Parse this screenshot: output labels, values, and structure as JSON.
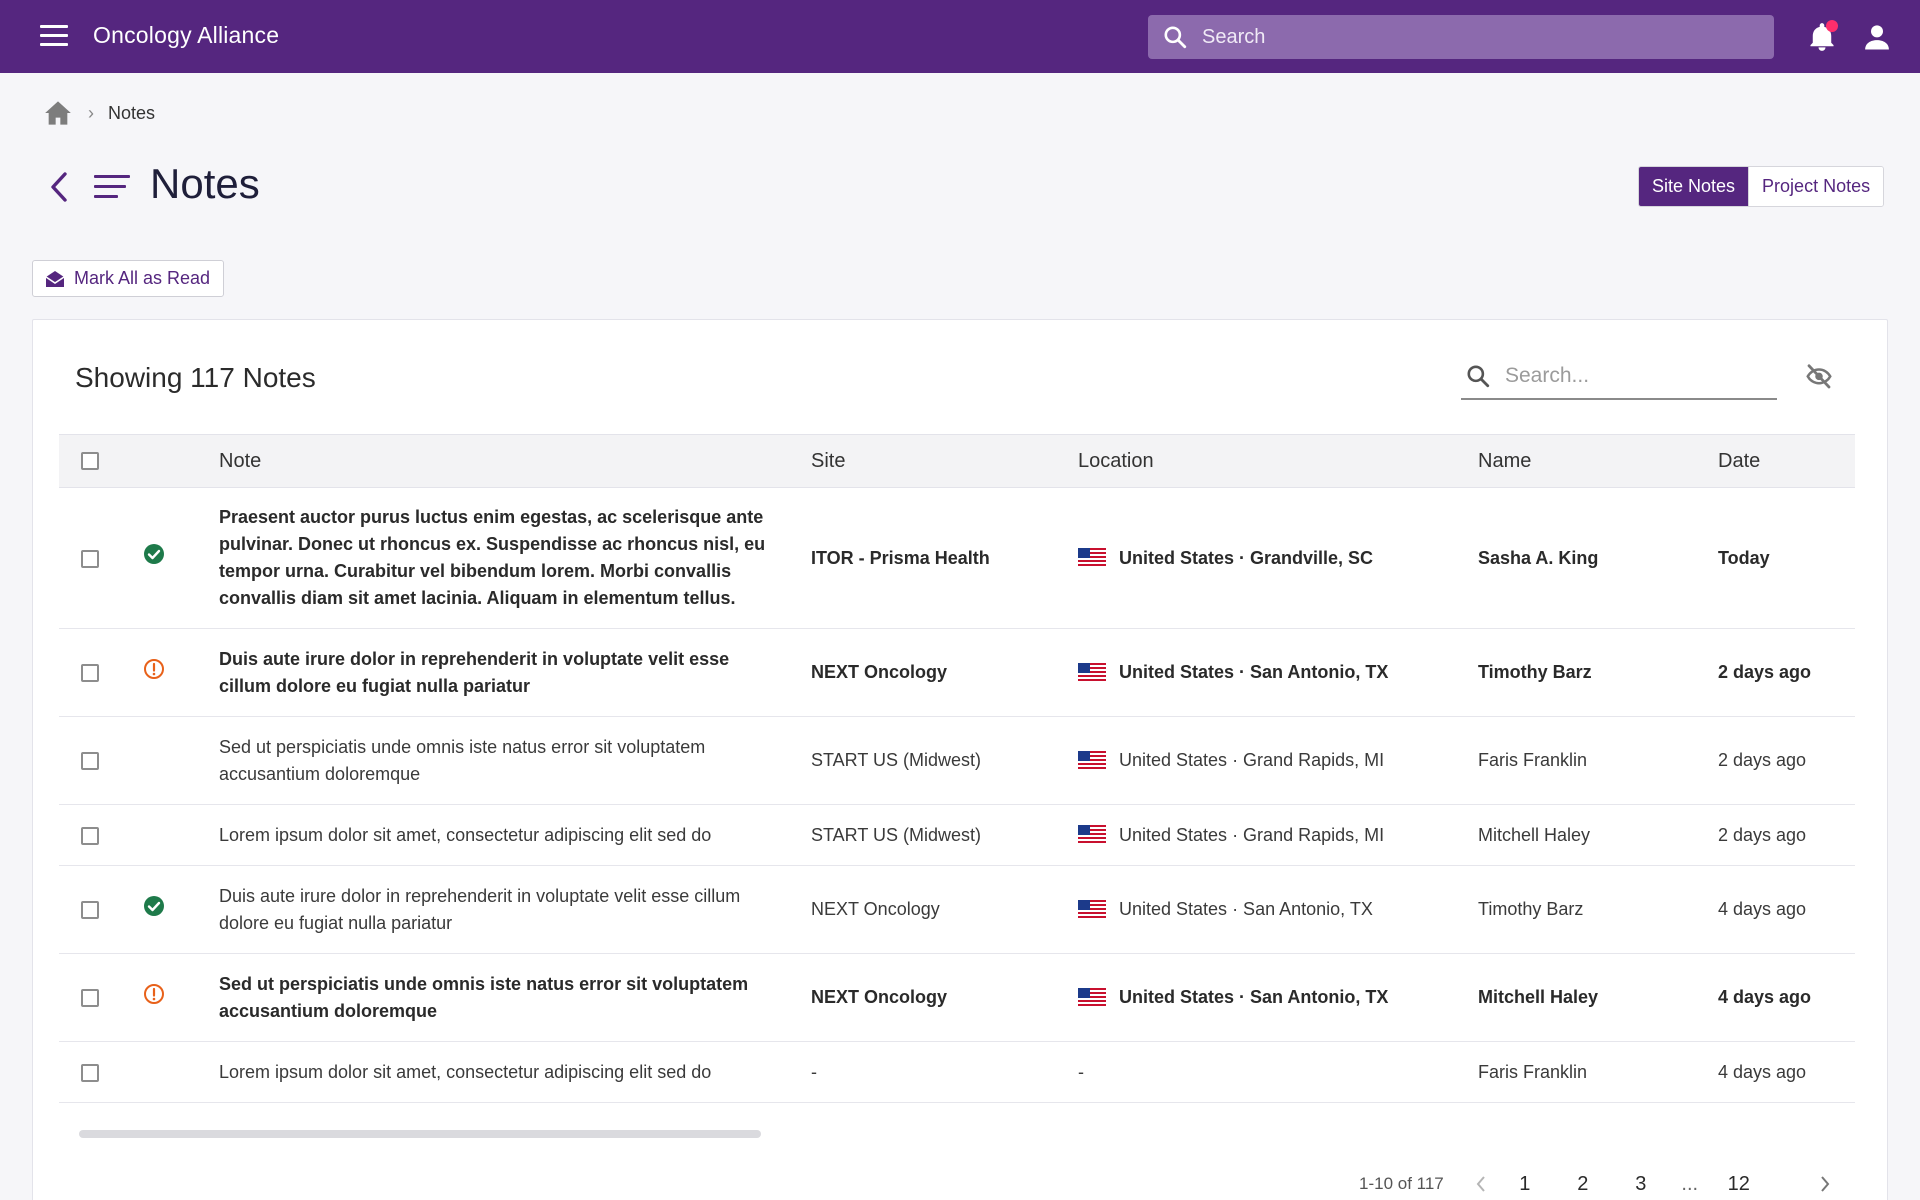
{
  "topbar": {
    "app_title": "Oncology Alliance",
    "search_placeholder": "Search",
    "colors": {
      "brand": "#55267f",
      "notification_dot": "#ff2e6c"
    }
  },
  "breadcrumb": {
    "current": "Notes"
  },
  "page": {
    "title": "Notes",
    "toggle": {
      "site_notes": "Site Notes",
      "project_notes": "Project Notes",
      "active": "Site Notes"
    },
    "mark_all_read": "Mark All as Read"
  },
  "card": {
    "showing": "Showing 117 Notes",
    "search_placeholder": "Search..."
  },
  "table": {
    "headers": {
      "note": "Note",
      "site": "Site",
      "location": "Location",
      "name": "Name",
      "date": "Date"
    },
    "rows": [
      {
        "status": "check",
        "unread": true,
        "note": "Praesent auctor purus luctus enim egestas, ac scelerisque ante pulvinar. Donec ut rhoncus ex. Suspendisse ac rhoncus nisl, eu tempor urna. Curabitur vel bibendum lorem. Morbi convallis convallis diam sit amet lacinia. Aliquam in elementum tellus.",
        "site": "ITOR - Prisma Health",
        "flag": true,
        "location": "United States · Grandville, SC",
        "name": "Sasha A. King",
        "date": "Today"
      },
      {
        "status": "alert",
        "unread": true,
        "note": "Duis aute irure dolor in reprehenderit in voluptate velit esse cillum dolore eu fugiat nulla pariatur",
        "site": "NEXT Oncology",
        "flag": true,
        "location": "United States · San Antonio, TX",
        "name": "Timothy Barz",
        "date": "2 days ago"
      },
      {
        "status": "none",
        "unread": false,
        "note": "Sed ut perspiciatis unde omnis iste natus error sit voluptatem accusantium doloremque",
        "site": "START US (Midwest)",
        "flag": true,
        "location": "United States · Grand Rapids, MI",
        "name": "Faris Franklin",
        "date": "2 days ago"
      },
      {
        "status": "none",
        "unread": false,
        "note": "Lorem ipsum dolor sit amet, consectetur adipiscing elit sed do",
        "site": "START US (Midwest)",
        "flag": true,
        "location": "United States · Grand Rapids, MI",
        "name": "Mitchell Haley",
        "date": "2 days ago"
      },
      {
        "status": "check",
        "unread": false,
        "note": "Duis aute irure dolor in reprehenderit in voluptate velit esse cillum dolore eu fugiat nulla pariatur",
        "site": "NEXT Oncology",
        "flag": true,
        "location": "United States · San Antonio, TX",
        "name": "Timothy Barz",
        "date": "4 days ago"
      },
      {
        "status": "alert",
        "unread": true,
        "note": "Sed ut perspiciatis unde omnis iste natus error sit voluptatem accusantium doloremque",
        "site": "NEXT Oncology",
        "flag": true,
        "location": "United States · San Antonio, TX",
        "name": "Mitchell Haley",
        "date": "4 days ago"
      },
      {
        "status": "none",
        "unread": false,
        "note": "Lorem ipsum dolor sit amet, consectetur adipiscing elit sed do",
        "site": "-",
        "flag": false,
        "location": "-",
        "name": "Faris Franklin",
        "date": "4 days ago"
      }
    ],
    "status_colors": {
      "check": "#1e7a4a",
      "alert": "#e8611a"
    }
  },
  "pagination": {
    "range": "1-10 of 117",
    "pages": [
      "1",
      "2",
      "3"
    ],
    "ellipsis": "...",
    "last": "12"
  }
}
